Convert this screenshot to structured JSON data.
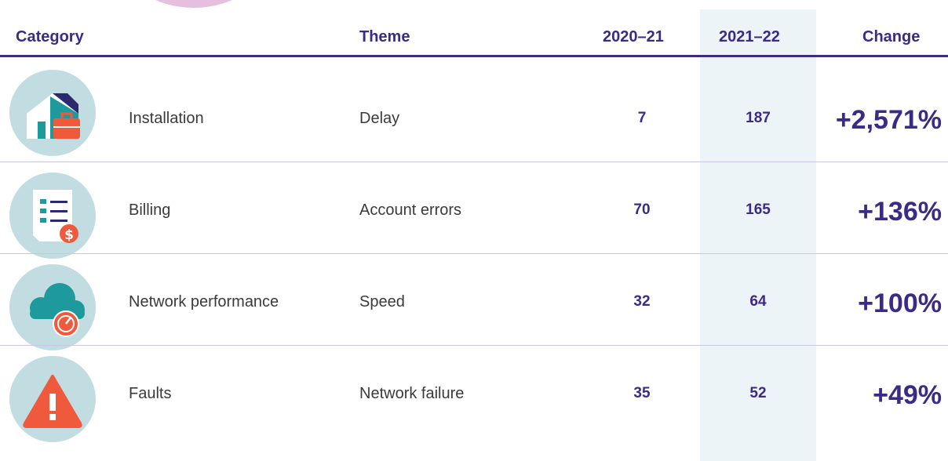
{
  "colors": {
    "accent": "#3b2a86",
    "highlight_column": "#edf4f7",
    "icon_circle": "#c1dde2",
    "icon_teal": "#1f9a9c",
    "icon_orange": "#f05a3c"
  },
  "headers": {
    "category": "Category",
    "theme": "Theme",
    "y2021": "2020–21",
    "y2122": "2021–22",
    "change": "Change"
  },
  "rows": [
    {
      "icon": "house-toolbox-icon",
      "category": "Installation",
      "theme": "Delay",
      "y2021": "7",
      "y2122": "187",
      "change": "+2,571%"
    },
    {
      "icon": "bill-dollar-icon",
      "category": "Billing",
      "theme": "Account errors",
      "y2021": "70",
      "y2122": "165",
      "change": "+136%"
    },
    {
      "icon": "cloud-gauge-icon",
      "category": "Network performance",
      "theme": "Speed",
      "y2021": "32",
      "y2122": "64",
      "change": "+100%"
    },
    {
      "icon": "warning-triangle-icon",
      "category": "Faults",
      "theme": "Network failure",
      "y2021": "35",
      "y2122": "52",
      "change": "+49%"
    }
  ]
}
